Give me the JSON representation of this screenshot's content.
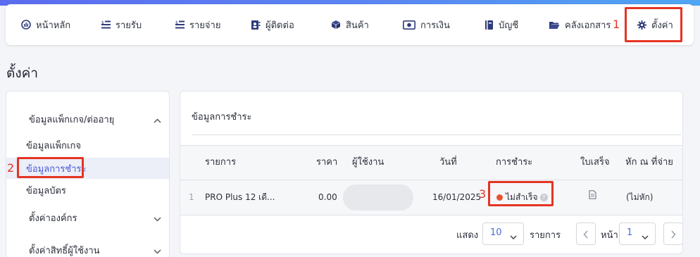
{
  "nav": {
    "items": [
      {
        "label": "หน้าหลัก",
        "icon": "dashboard-gauge-icon"
      },
      {
        "label": "รายรับ",
        "icon": "income-list-icon"
      },
      {
        "label": "รายจ่าย",
        "icon": "expense-list-icon"
      },
      {
        "label": "ผู้ติดต่อ",
        "icon": "contacts-book-icon"
      },
      {
        "label": "สินค้า",
        "icon": "product-box-icon"
      },
      {
        "label": "การเงิน",
        "icon": "money-bill-icon"
      },
      {
        "label": "บัญชี",
        "icon": "ledger-book-icon"
      },
      {
        "label": "คลังเอกสาร",
        "icon": "folder-open-icon"
      },
      {
        "label": "ตั้งค่า",
        "icon": "gear-icon"
      }
    ]
  },
  "annotations": {
    "marker_1": "1",
    "marker_2": "2",
    "marker_3": "3",
    "color": "#e53424"
  },
  "page": {
    "title": "ตั้งค่า"
  },
  "sidebar": {
    "group_package": "ข้อมูลแพ็กเกจ/ต่ออายุ",
    "sub_items": [
      "ข้อมูลแพ็กเกจ",
      "ข้อมูลการชำระ",
      "ข้อมูลบัตร"
    ],
    "group_org": "ตั้งค่าองค์กร",
    "group_permissions": "ตั้งค่าสิทธิ์ผู้ใช้งาน"
  },
  "payment": {
    "title": "ข้อมูลการชำระ",
    "columns": [
      "รายการ",
      "ราคา",
      "ผู้ใช้งาน",
      "วันที่",
      "การชำระ",
      "ใบเสร็จ",
      "หัก ณ ที่จ่าย"
    ],
    "rows": [
      {
        "index": "1",
        "item": "PRO Plus 12 เดื...",
        "price": "0.00",
        "user": "",
        "date": "16/01/2025",
        "status": "ไม่สำเร็จ",
        "status_color": "#e8542f",
        "receipt_icon": "document-icon",
        "withholding": "(ไม่หัก)"
      }
    ]
  },
  "footer": {
    "show_label": "แสดง",
    "page_size": "10",
    "items_label": "รายการ",
    "page_label": "หน้า",
    "page_number": "1"
  },
  "colors": {
    "accent": "#4a5ad8",
    "top_gradient_start": "#5c6bf0",
    "top_gradient_end": "#4fa6f2"
  }
}
